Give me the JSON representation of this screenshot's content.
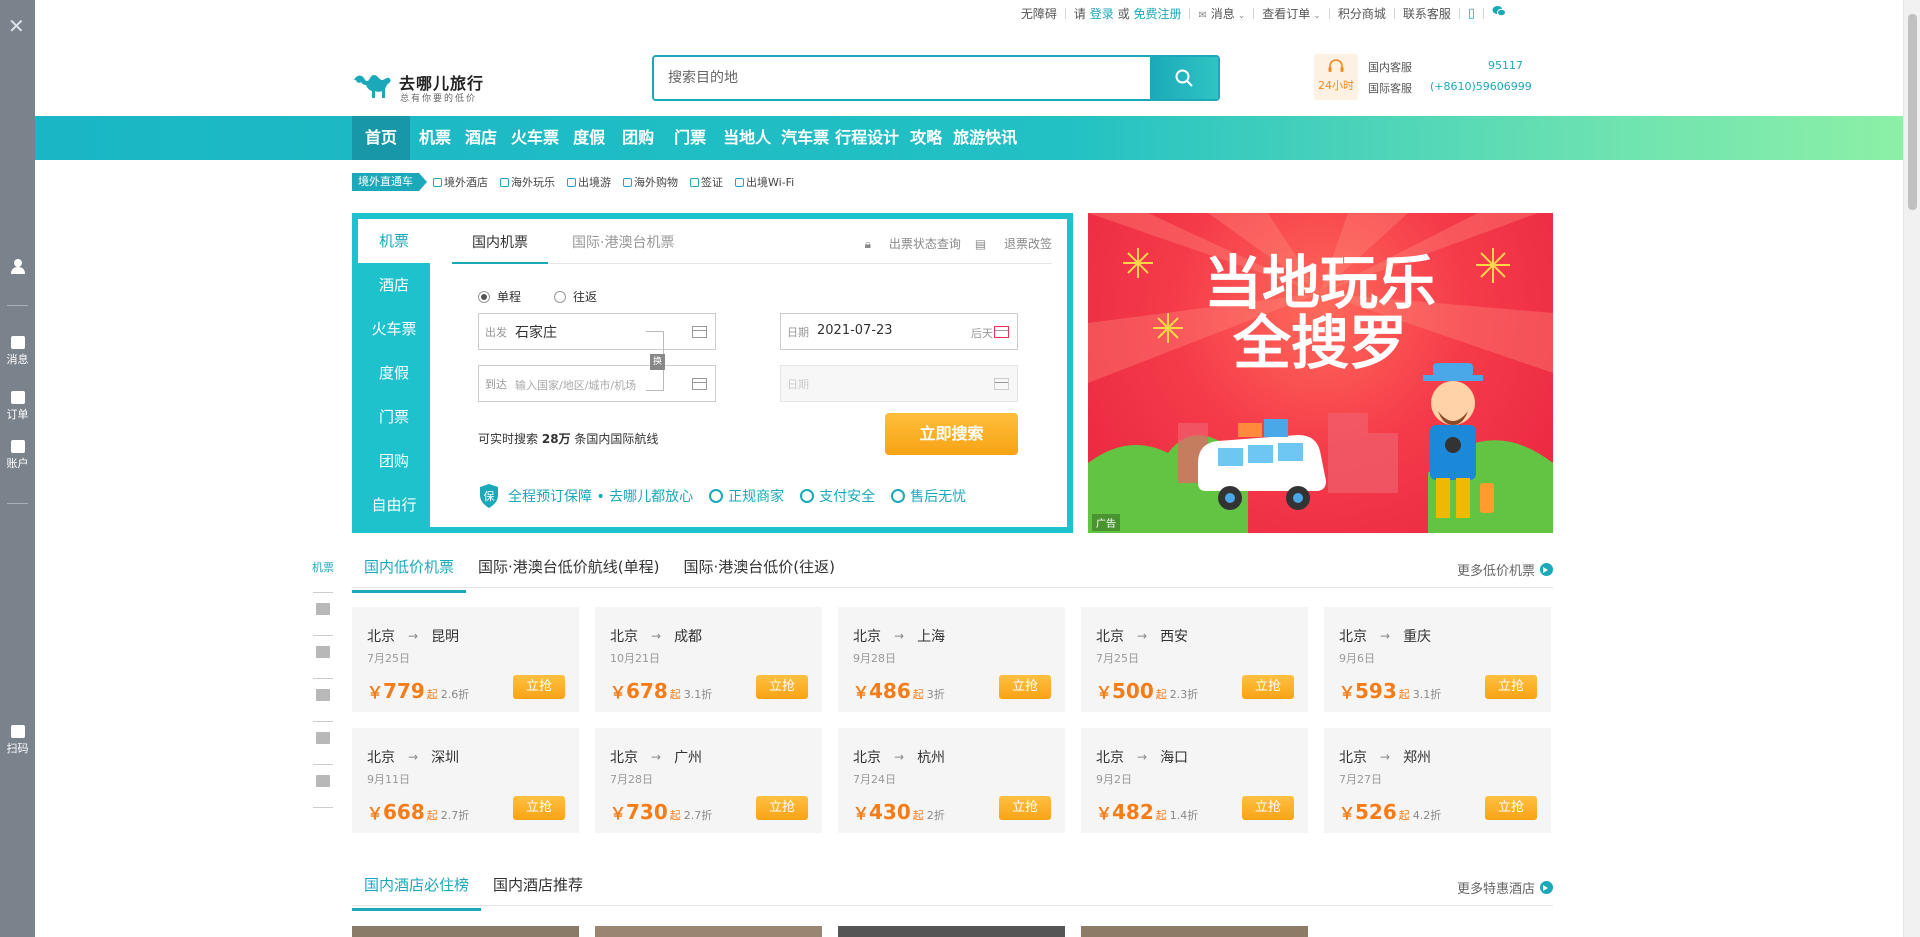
{
  "left_rail": {
    "items": [
      {
        "label": "消息"
      },
      {
        "label": "订单"
      },
      {
        "label": "账户"
      },
      {
        "label": "扫码"
      }
    ]
  },
  "topbar": {
    "accessibility": "无障碍",
    "please": "请",
    "login": "登录",
    "or": "或",
    "register": "免费注册",
    "messages": "消息",
    "orders": "查看订单",
    "points_mall": "积分商城",
    "customer_service": "联系客服"
  },
  "logo": {
    "title": "去哪儿旅行",
    "slogan": "总有你要的低价"
  },
  "search": {
    "placeholder": "搜索目的地"
  },
  "service": {
    "badge": "24小时",
    "domestic_label": "国内客服",
    "domestic_number": "95117",
    "intl_label": "国际客服",
    "intl_number": "(+8610)59606999"
  },
  "nav": {
    "items": [
      "首页",
      "机票",
      "酒店",
      "火车票",
      "度假",
      "团购",
      "门票",
      "当地人",
      "汽车票",
      "行程设计",
      "攻略",
      "旅游快讯"
    ]
  },
  "abroad": {
    "tag": "境外直通车",
    "items": [
      "境外酒店",
      "海外玩乐",
      "出境游",
      "海外购物",
      "签证",
      "出境Wi-Fi"
    ]
  },
  "booking": {
    "vtabs": [
      "机票",
      "酒店",
      "火车票",
      "度假",
      "门票",
      "团购",
      "自由行"
    ],
    "htabs": [
      "国内机票",
      "国际·港澳台机票"
    ],
    "links": [
      "出票状态查询",
      "退票改签"
    ],
    "trip_types": [
      "单程",
      "往返"
    ],
    "from_label": "出发",
    "from_value": "石家庄",
    "to_label": "到达",
    "to_placeholder": "输入国家/地区/城市/机场",
    "swap": "换",
    "date_label": "日期",
    "date_value": "2021-07-23",
    "date_hint": "后天",
    "return_label": "日期",
    "hint_prefix": "可实时搜索",
    "hint_count": "28万",
    "hint_suffix": "条国内国际航线",
    "search_button": "立即搜索",
    "guarantee_main": "全程预订保障 • 去哪儿都放心",
    "guarantees": [
      "正规商家",
      "支付安全",
      "售后无忧"
    ]
  },
  "banner": {
    "line1": "当地玩乐",
    "line2": "全搜罗",
    "ad": "广告"
  },
  "sidenav": {
    "items": [
      "机票"
    ]
  },
  "flights_section": {
    "tabs": [
      "国内低价机票",
      "国际·港澳台低价航线(单程)",
      "国际·港澳台低价(往返)"
    ],
    "more": "更多低价机票",
    "currency": "￥",
    "qi": "起",
    "grab": "立抢",
    "cards": [
      {
        "from": "北京",
        "to": "昆明",
        "date": "7月25日",
        "price": "779",
        "discount": "2.6折"
      },
      {
        "from": "北京",
        "to": "成都",
        "date": "10月21日",
        "price": "678",
        "discount": "3.1折"
      },
      {
        "from": "北京",
        "to": "上海",
        "date": "9月28日",
        "price": "486",
        "discount": "3折"
      },
      {
        "from": "北京",
        "to": "西安",
        "date": "7月25日",
        "price": "500",
        "discount": "2.3折"
      },
      {
        "from": "北京",
        "to": "重庆",
        "date": "9月6日",
        "price": "593",
        "discount": "3.1折"
      },
      {
        "from": "北京",
        "to": "深圳",
        "date": "9月11日",
        "price": "668",
        "discount": "2.7折"
      },
      {
        "from": "北京",
        "to": "广州",
        "date": "7月28日",
        "price": "730",
        "discount": "2.7折"
      },
      {
        "from": "北京",
        "to": "杭州",
        "date": "7月24日",
        "price": "430",
        "discount": "2折"
      },
      {
        "from": "北京",
        "to": "海口",
        "date": "9月2日",
        "price": "482",
        "discount": "1.4折"
      },
      {
        "from": "北京",
        "to": "郑州",
        "date": "7月27日",
        "price": "526",
        "discount": "4.2折"
      }
    ]
  },
  "hotels_section": {
    "tabs": [
      "国内酒店必住榜",
      "国内酒店推荐"
    ],
    "more": "更多特惠酒店"
  },
  "colors": {
    "accent": "#1ba9ba",
    "orange": "#f8a316",
    "price": "#f57c16"
  }
}
